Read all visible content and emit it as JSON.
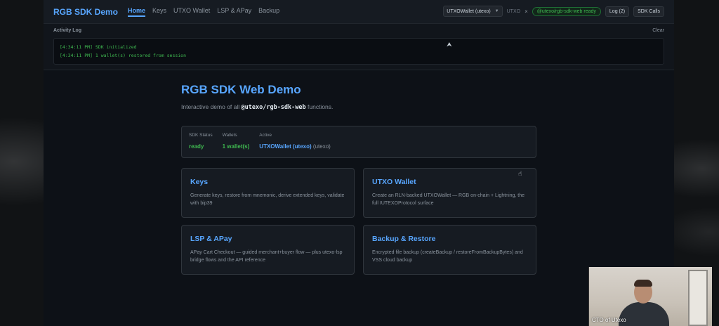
{
  "header": {
    "brand": "RGB SDK Demo",
    "nav": [
      {
        "label": "Home",
        "active": true
      },
      {
        "label": "Keys"
      },
      {
        "label": "UTXO Wallet"
      },
      {
        "label": "LSP & APay"
      },
      {
        "label": "Backup"
      }
    ],
    "wallet_select": "UTXOWallet (utexo)",
    "protocol": "UTXO",
    "close": "×",
    "package_badge": "@utexo/rgb-sdk-web ready",
    "log_button": "Log (2)",
    "sdk_calls_button": "SDK Calls"
  },
  "activity_log": {
    "title": "Activity Log",
    "clear_label": "Clear",
    "entries": [
      "[4:34:11 PM] SDK initialized",
      "[4:34:11 PM] 1 wallet(s) restored from session"
    ]
  },
  "main": {
    "title": "RGB SDK Web Demo",
    "subtitle_prefix": "Interactive demo of all ",
    "subtitle_package": "@utexo/rgb-sdk-web",
    "subtitle_suffix": " functions.",
    "status": {
      "sdk_label": "SDK Status",
      "sdk_value": "ready",
      "wallets_label": "Wallets",
      "wallets_value": "1 wallet(s)",
      "active_label": "Active",
      "active_value": "UTXOWallet (utexo)",
      "active_tag": "(utexo)"
    },
    "cards": [
      {
        "title": "Keys",
        "description": "Generate keys, restore from mnemonic, derive extended keys, validate with bip39"
      },
      {
        "title": "UTXO Wallet",
        "description": "Create an RLN-backed UTXOWallet — RGB on-chain + Lightning, the full IUTEXOProtocol surface"
      },
      {
        "title": "LSP & APay",
        "description": "APay Cart Checkout — guided merchant+buyer flow — plus utexo-lsp bridge flows and the API reference"
      },
      {
        "title": "Backup & Restore",
        "description": "Encrypted file backup (createBackup / restoreFromBackupBytes) and VSS cloud backup"
      }
    ]
  },
  "webcam": {
    "label": "CTO of Utexo"
  },
  "colors": {
    "accent": "#58a6ff",
    "success": "#3fb950",
    "panel": "#161b22",
    "background": "#0d1117"
  }
}
